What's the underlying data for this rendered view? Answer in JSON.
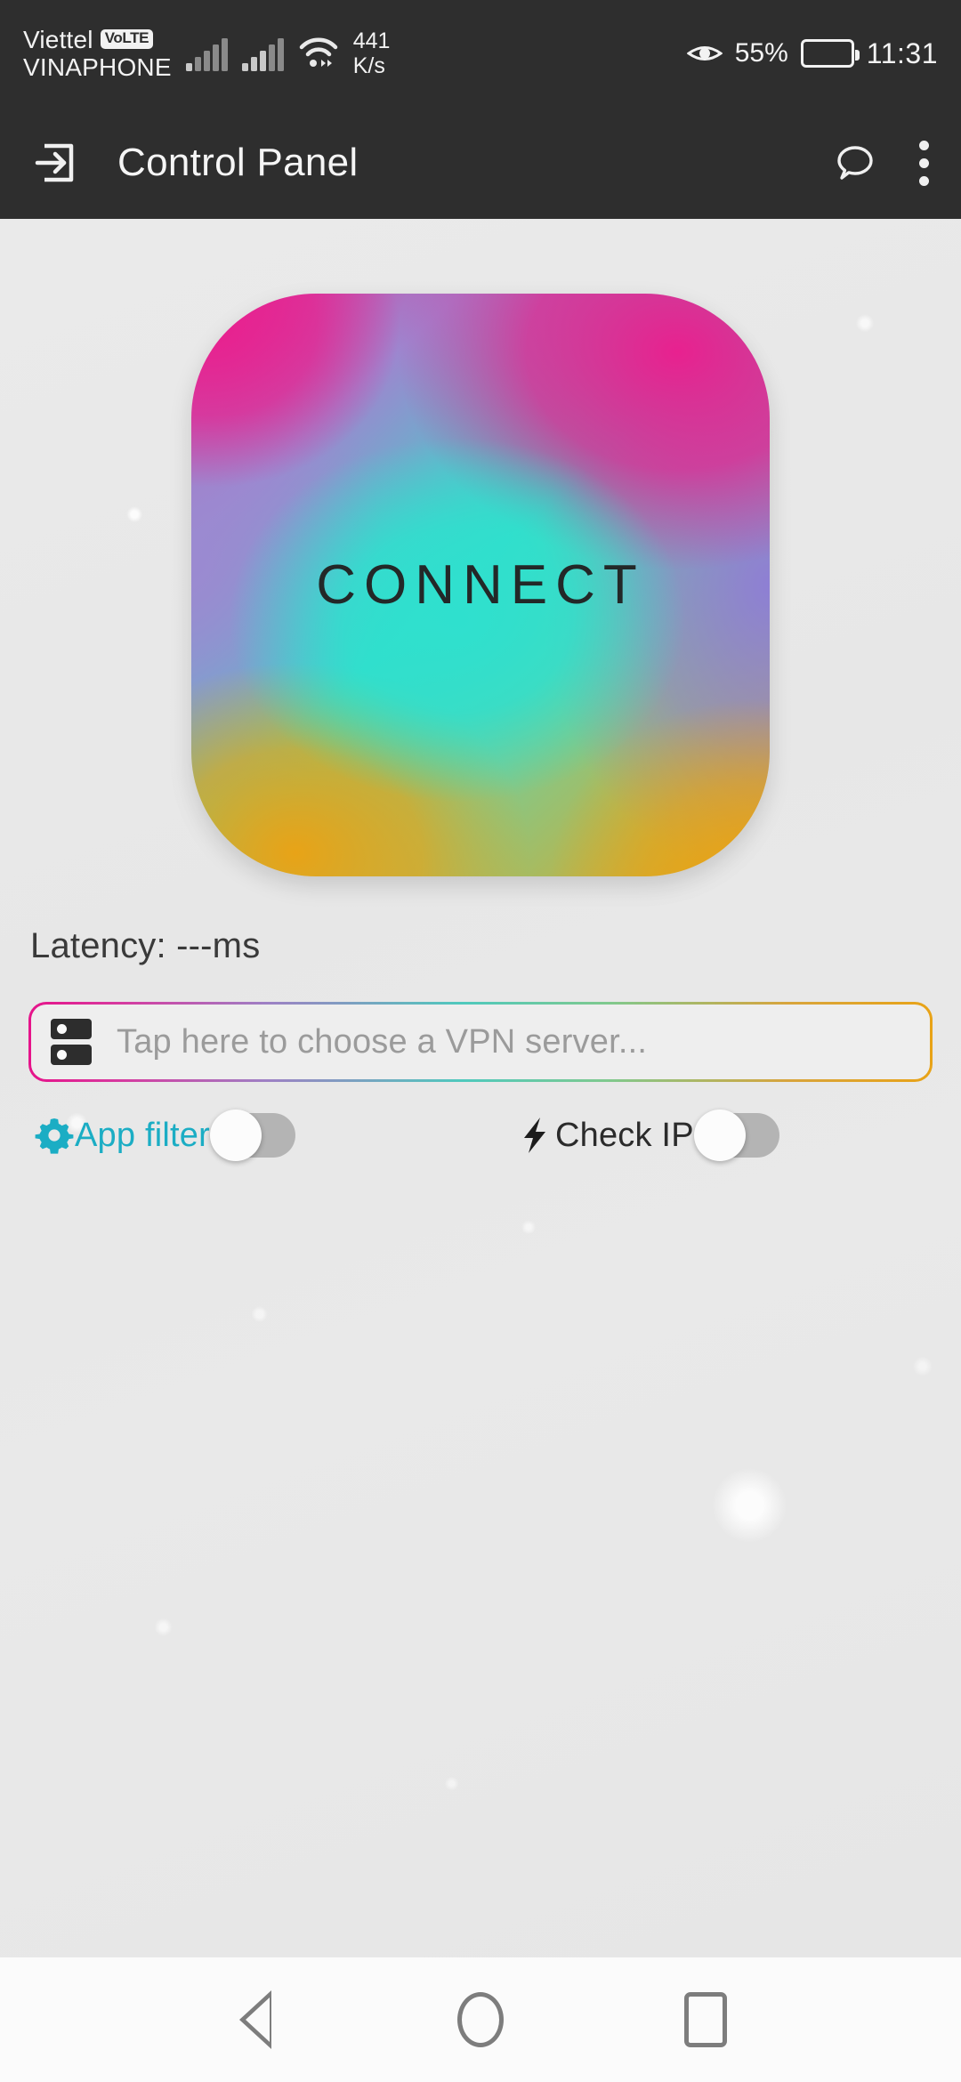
{
  "statusbar": {
    "carrier_primary": "Viettel",
    "volte_badge": "VoLTE",
    "carrier_secondary": "VINAPHONE",
    "net_speed_value": "441",
    "net_speed_unit": "K/s",
    "battery_percent": "55%",
    "clock": "11:31",
    "icons": {
      "signal_1": "signal-bars-icon",
      "signal_2": "signal-bars-icon",
      "wifi": "wifi-icon",
      "eye": "eye-icon",
      "battery": "battery-icon"
    }
  },
  "appbar": {
    "title": "Control Panel",
    "nav_icon": "login-arrow-icon",
    "chat_icon": "speech-bubble-icon",
    "overflow_icon": "kebab-menu-icon"
  },
  "main": {
    "connect_button": {
      "label": "CONNECT",
      "state": "disconnected"
    },
    "latency": {
      "text": "Latency: ---ms"
    },
    "server_picker": {
      "placeholder": "Tap here to choose a VPN server...",
      "icon": "server-rack-icon",
      "value": ""
    },
    "toggles": [
      {
        "label": "App filter",
        "icon": "gear-icon",
        "enabled": false
      },
      {
        "label": "Check IP",
        "icon": "lightning-bolt-icon",
        "enabled": false
      }
    ]
  },
  "navbar": {
    "back": "back-triangle-icon",
    "home": "home-circle-icon",
    "recents": "recents-square-icon"
  },
  "colors": {
    "statusbar_bg": "#2e2e2e",
    "appbar_bg": "#2e2e2e",
    "content_bg": "#e8e8e8",
    "accent_cyan": "#1badc4",
    "gradient_pink": "#e6138a",
    "gradient_teal": "#36dbc8",
    "gradient_orange": "#e8a317",
    "gradient_purple": "#9d86cf",
    "navbar_bg": "#fbfbfb"
  }
}
